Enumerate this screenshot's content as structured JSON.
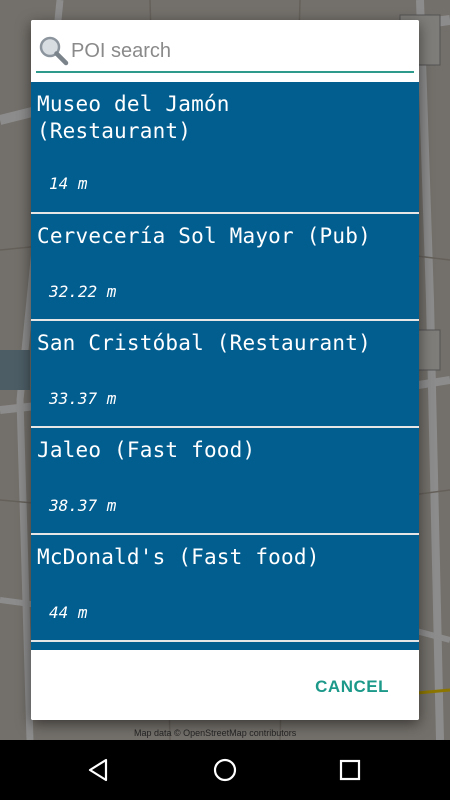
{
  "search": {
    "placeholder": "POI search",
    "value": ""
  },
  "results": [
    {
      "name": "Museo del Jamón\n(Restaurant)",
      "distance": "14 m"
    },
    {
      "name": "Cervecería Sol Mayor (Pub)",
      "distance": "32.22 m"
    },
    {
      "name": "San Cristóbal (Restaurant)",
      "distance": "33.37 m"
    },
    {
      "name": "Jaleo (Fast food)",
      "distance": "38.37 m"
    },
    {
      "name": "McDonald's (Fast food)",
      "distance": "44 m"
    }
  ],
  "buttons": {
    "cancel": "CANCEL"
  },
  "map": {
    "attribution": "Map data © OpenStreetMap contributors"
  },
  "colors": {
    "item_background": "#035e90",
    "accent": "#1d998a"
  },
  "icons": {
    "search": "search-icon",
    "back": "back-triangle-icon",
    "home": "home-circle-icon",
    "recents": "recents-square-icon"
  }
}
